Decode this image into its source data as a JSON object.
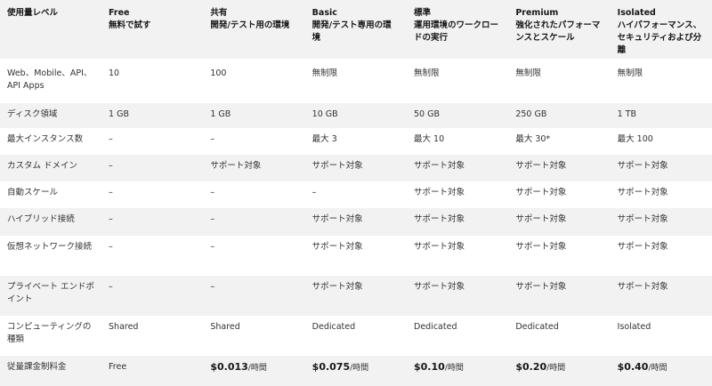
{
  "header": {
    "row_label": "使用量レベル",
    "tiers": [
      {
        "name": "Free",
        "desc": "無料で試す"
      },
      {
        "name": "共有",
        "desc": "開発/テスト用の環境"
      },
      {
        "name": "Basic",
        "desc": "開発/テスト専用の環境"
      },
      {
        "name": "標準",
        "desc": "運用環境のワークロードの実行"
      },
      {
        "name": "Premium",
        "desc": "強化されたパフォーマンスとスケール"
      },
      {
        "name": "Isolated",
        "desc": "ハイパフォーマンス、セキュリティおよび分離"
      }
    ]
  },
  "rows": [
    {
      "label": "Web、Mobile、API、API Apps",
      "values": [
        "10",
        "100",
        "無制限",
        "無制限",
        "無制限",
        "無制限"
      ]
    },
    {
      "label": "ディスク領域",
      "values": [
        "1 GB",
        "1 GB",
        "10 GB",
        "50 GB",
        "250 GB",
        "1 TB"
      ]
    },
    {
      "label": "最大インスタンス数",
      "values": [
        "–",
        "–",
        "最大 3",
        "最大 10",
        "最大 30*",
        "最大 100"
      ]
    },
    {
      "label": "カスタム ドメイン",
      "values": [
        "–",
        "サポート対象",
        "サポート対象",
        "サポート対象",
        "サポート対象",
        "サポート対象"
      ]
    },
    {
      "label": "自動スケール",
      "values": [
        "–",
        "–",
        "–",
        "サポート対象",
        "サポート対象",
        "サポート対象"
      ]
    },
    {
      "label": "ハイブリッド接続",
      "values": [
        "–",
        "–",
        "サポート対象",
        "サポート対象",
        "サポート対象",
        "サポート対象"
      ]
    },
    {
      "label": "仮想ネットワーク接続",
      "values": [
        "–",
        "–",
        "サポート対象",
        "サポート対象",
        "サポート対象",
        "サポート対象"
      ]
    },
    {
      "label": "プライベート エンドポイント",
      "values": [
        "–",
        "–",
        "サポート対象",
        "サポート対象",
        "サポート対象",
        "サポート対象"
      ]
    },
    {
      "label": "コンピューティングの種類",
      "values": [
        "Shared",
        "Shared",
        "Dedicated",
        "Dedicated",
        "Dedicated",
        "Isolated"
      ]
    }
  ],
  "price_row": {
    "label": "従量課金制料金",
    "free": "Free",
    "unit": "/時間",
    "prices": [
      "$0.013",
      "$0.075",
      "$0.10",
      "$0.20",
      "$0.40"
    ]
  }
}
